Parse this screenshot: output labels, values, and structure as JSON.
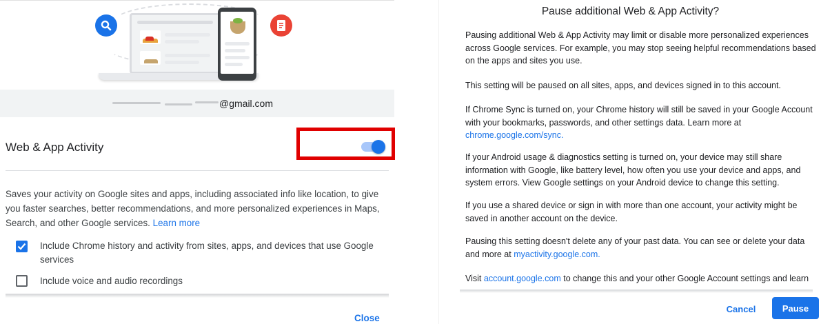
{
  "left_panel": {
    "email_suffix": "@gmail.com",
    "setting_title": "Web & App Activity",
    "toggle_on": true,
    "description": "Saves your activity on Google sites and apps, including associated info like location, to give you faster searches, better recommendations, and more personalized experiences in Maps, Search, and other Google services.",
    "learn_more": "Learn more",
    "checkboxes": [
      {
        "label": "Include Chrome history and activity from sites, apps, and devices that use Google services",
        "checked": true
      },
      {
        "label": "Include voice and audio recordings",
        "checked": false
      }
    ],
    "close_label": "Close",
    "icons": [
      "search-icon",
      "document-icon"
    ],
    "colors": {
      "accent": "#1a73e8",
      "highlight": "#e00000",
      "doc_red": "#ea4335"
    }
  },
  "dialog": {
    "title": "Pause additional Web & App Activity?",
    "p1": "Pausing additional Web & App Activity may limit or disable more personalized experiences across Google services. For example, you may stop seeing helpful recommendations based on the apps and sites you use.",
    "p2": "This setting will be paused on all sites, apps, and devices signed in to this account.",
    "p3_text": "If Chrome Sync is turned on, your Chrome history will still be saved in your Google Account with your bookmarks, passwords, and other settings data. Learn more at",
    "p3_link": "chrome.google.com/sync.",
    "p4": "If your Android usage & diagnostics setting is turned on, your device may still share information with Google, like battery level, how often you use your device and apps, and system errors. View Google settings on your Android device to change this setting.",
    "p5": "If you use a shared device or sign in with more than one account, your activity might be saved in another account on the device.",
    "p6_text": "Pausing this setting doesn't delete any of your past data. You can see or delete your data and more at",
    "p6_link": "myactivity.google.com.",
    "p7_before": "Visit",
    "p7_link": "account.google.com",
    "p7_after": "to change this and your other Google Account settings and learn",
    "cancel_label": "Cancel",
    "pause_label": "Pause"
  }
}
